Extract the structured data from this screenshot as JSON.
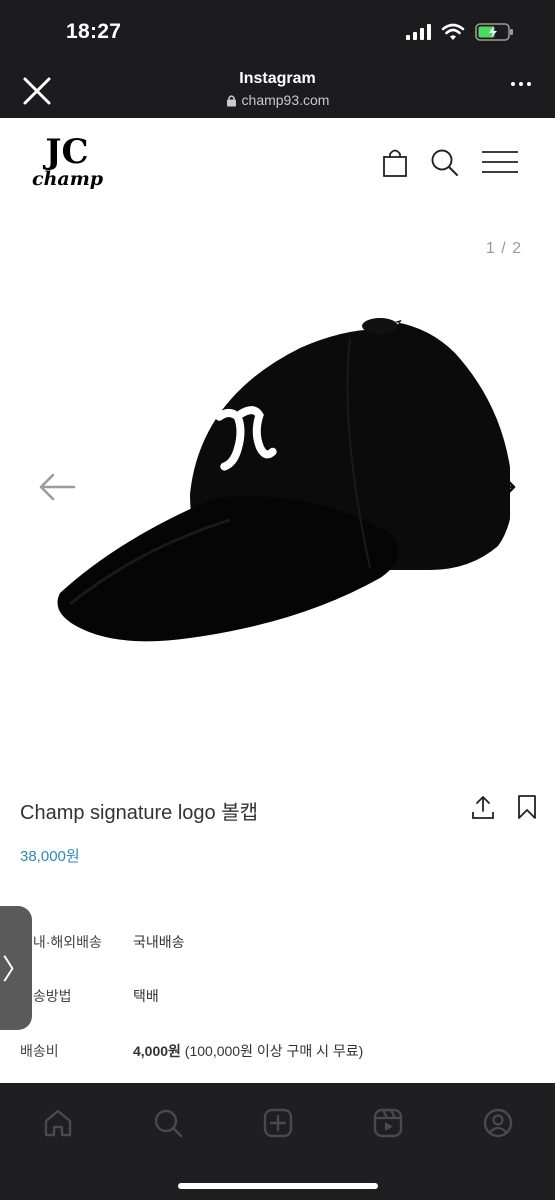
{
  "status": {
    "time": "18:27"
  },
  "browser": {
    "title": "Instagram",
    "url": "champ93.com"
  },
  "site": {
    "logo_mark": "JC",
    "logo_word": "champ"
  },
  "gallery": {
    "counter": "1 / 2"
  },
  "product": {
    "name": "Champ signature logo 볼캡",
    "price": "38,000원",
    "rows": [
      {
        "key": "국내·해외배송",
        "value": "국내배송"
      },
      {
        "key": "배송방법",
        "value": "택배"
      },
      {
        "key": "배송비",
        "value_bold": "4,000원",
        "value_rest": " (100,000원 이상 구매 시 무료)"
      }
    ]
  },
  "side_tab": {
    "glyph": "〉"
  },
  "icons": {
    "close": "close-icon",
    "lock": "lock-icon",
    "more": "more-icon",
    "cart": "shopping-bag-icon",
    "search": "search-icon",
    "menu": "hamburger-menu-icon",
    "prev": "arrow-left-icon",
    "next": "arrow-right-icon",
    "share": "share-icon",
    "bookmark": "bookmark-icon",
    "nav": [
      "home-icon",
      "search-icon",
      "create-icon",
      "reels-icon",
      "profile-icon"
    ]
  },
  "colors": {
    "price": "#2a8bb5",
    "chrome": "#1c1c1e",
    "battery": "#4cd964"
  }
}
